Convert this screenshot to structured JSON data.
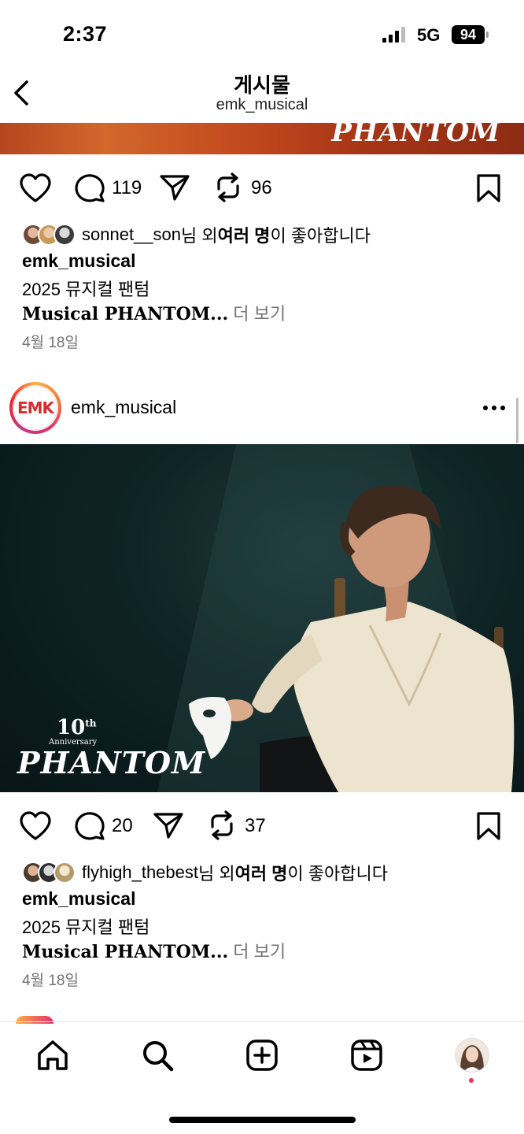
{
  "status": {
    "time": "2:37",
    "network": "5G",
    "battery": "94"
  },
  "header": {
    "title": "게시물",
    "subtitle": "emk_musical"
  },
  "strip": {
    "logo_text": "PHANTOM"
  },
  "post1": {
    "comments": "119",
    "reposts": "96",
    "liked_by_user": "sonnet__son",
    "liked_by_suffix1": "님 외 ",
    "liked_by_bold": "여러 명",
    "liked_by_suffix2": "이 좋아합니다",
    "author": "emk_musical",
    "caption1": "2025 뮤지컬 팬텀",
    "caption2": "Musical PHANTOM...",
    "more": " 더 보기",
    "date": "4월 18일"
  },
  "post2": {
    "avatar_text": "EMK",
    "username": "emk_musical",
    "photo_logo_num": "10",
    "photo_logo_sup": "th",
    "photo_anniv": "Anniversary",
    "photo_title": "PHANTOM",
    "comments": "20",
    "reposts": "37",
    "liked_by_user": "flyhigh_thebest",
    "liked_by_suffix1": "님 외 ",
    "liked_by_bold": "여러 명",
    "liked_by_suffix2": "이 좋아합니다",
    "author": "emk_musical",
    "caption1": "2025 뮤지컬 팬텀",
    "caption2": "Musical PHANTOM...",
    "more": " 더 보기",
    "date": "4월 18일"
  },
  "icons": {
    "like": "heart-icon",
    "comment": "comment-icon",
    "share": "send-icon",
    "repost": "repost-icon",
    "save": "bookmark-icon",
    "nav": [
      "home-icon",
      "search-icon",
      "create-icon",
      "reels-icon",
      "profile-avatar"
    ]
  },
  "colors": {
    "notification_dot": "#ff2d55",
    "brand_red": "#d32f2f"
  }
}
